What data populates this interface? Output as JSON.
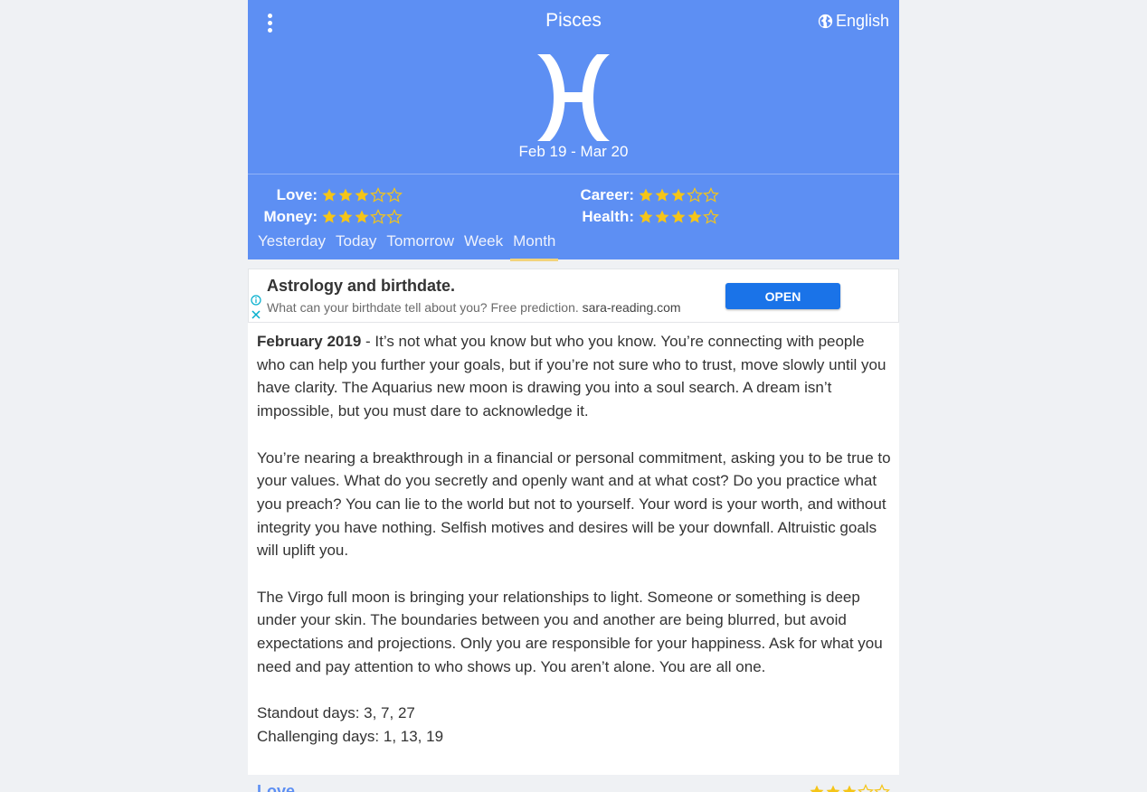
{
  "header": {
    "title": "Pisces",
    "language": "English",
    "date_range": "Feb 19 - Mar 20"
  },
  "ratings": [
    {
      "label": "Love:",
      "score": 3,
      "max": 5
    },
    {
      "label": "Career:",
      "score": 3,
      "max": 5
    },
    {
      "label": "Money:",
      "score": 3,
      "max": 5
    },
    {
      "label": "Health:",
      "score": 4,
      "max": 5
    }
  ],
  "tabs": [
    {
      "label": "Yesterday"
    },
    {
      "label": "Today"
    },
    {
      "label": "Tomorrow"
    },
    {
      "label": "Week"
    },
    {
      "label": "Month",
      "active": true
    }
  ],
  "ad": {
    "title": "Astrology and birthdate.",
    "description": "What can your birthdate tell about you? Free prediction.",
    "domain": "sara-reading.com",
    "button": "OPEN"
  },
  "horoscope": {
    "period": "February 2019",
    "paragraph1": " - It’s not what you know but who you know. You’re connecting with people who can help you further your goals, but if you’re not sure who to trust, move slowly until you have clarity. The Aquarius new moon is drawing you into a soul search. A dream isn’t impossible, but you must dare to acknowledge it.",
    "paragraph2": "You’re nearing a breakthrough in a financial or personal commitment, asking you to be true to your values. What do you secretly and openly want and at what cost? Do you practice what you preach? You can lie to the world but not to yourself. Your word is your worth, and without integrity you have nothing. Selfish motives and desires will be your downfall. Altruistic goals will uplift you.",
    "paragraph3": "The Virgo full moon is bringing your relationships to light. Someone or something is deep under your skin. The boundaries between you and another are being blurred, but avoid expectations and projections. Only you are responsible for your happiness. Ask for what you need and pay attention to who shows up. You aren’t alone. You are all one.",
    "standout": "Standout days: 3, 7, 27",
    "challenging": "Challenging days: 1, 13, 19"
  },
  "next_section": {
    "label": "Love",
    "score": 3,
    "max": 5
  },
  "colors": {
    "header_bg": "#5d8ff3",
    "star": "#f5c518",
    "tab_underline": "#f2d37b",
    "ad_button": "#1a73e8"
  }
}
